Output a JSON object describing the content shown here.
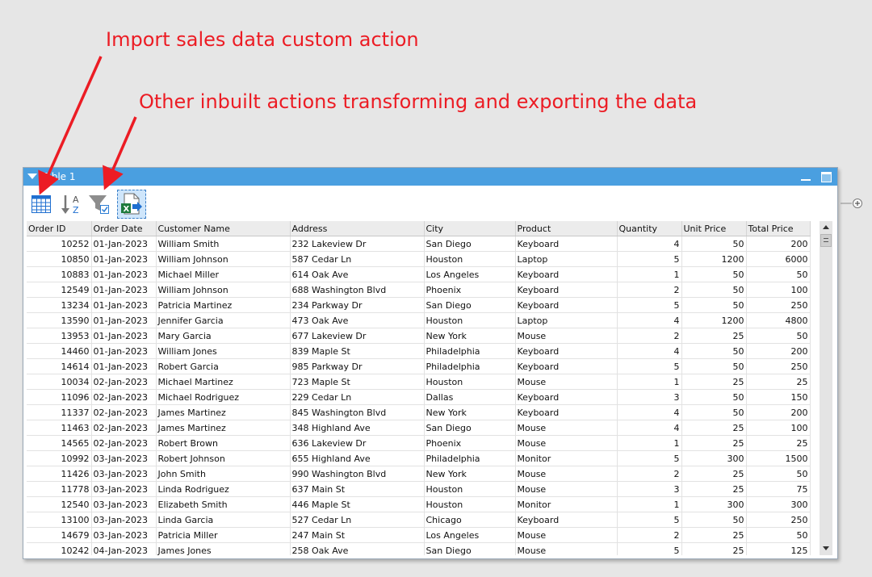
{
  "annotations": {
    "custom_action": "Import sales data custom action",
    "inbuilt_actions": "Other inbuilt actions transforming and exporting the data",
    "color": "#ec1c24"
  },
  "panel": {
    "title": "Table 1",
    "accent": "#4a9fe0"
  },
  "toolbar": {
    "buttons": [
      {
        "icon": "table-grid-icon",
        "purpose": "import-sales-data"
      },
      {
        "icon": "sort-az-icon",
        "purpose": "sort"
      },
      {
        "icon": "filter-icon",
        "purpose": "filter"
      },
      {
        "icon": "export-excel-icon",
        "purpose": "export",
        "active": true
      }
    ],
    "sort_letters": {
      "top": "A",
      "bottom": "Z"
    },
    "excel_letter": "X"
  },
  "table": {
    "columns": [
      "Order ID",
      "Order Date",
      "Customer Name",
      "Address",
      "City",
      "Product",
      "Quantity",
      "Unit Price",
      "Total Price"
    ],
    "rows": [
      [
        "10252",
        "01-Jan-2023",
        "William Smith",
        "232 Lakeview Dr",
        "San Diego",
        "Keyboard",
        "4",
        "50",
        "200"
      ],
      [
        "10850",
        "01-Jan-2023",
        "William Johnson",
        "587 Cedar Ln",
        "Houston",
        "Laptop",
        "5",
        "1200",
        "6000"
      ],
      [
        "10883",
        "01-Jan-2023",
        "Michael Miller",
        "614 Oak Ave",
        "Los Angeles",
        "Keyboard",
        "1",
        "50",
        "50"
      ],
      [
        "12549",
        "01-Jan-2023",
        "William Johnson",
        "688 Washington Blvd",
        "Phoenix",
        "Keyboard",
        "2",
        "50",
        "100"
      ],
      [
        "13234",
        "01-Jan-2023",
        "Patricia Martinez",
        "234 Parkway Dr",
        "San Diego",
        "Keyboard",
        "5",
        "50",
        "250"
      ],
      [
        "13590",
        "01-Jan-2023",
        "Jennifer Garcia",
        "473 Oak Ave",
        "Houston",
        "Laptop",
        "4",
        "1200",
        "4800"
      ],
      [
        "13953",
        "01-Jan-2023",
        "Mary Garcia",
        "677 Lakeview Dr",
        "New York",
        "Mouse",
        "2",
        "25",
        "50"
      ],
      [
        "14460",
        "01-Jan-2023",
        "William Jones",
        "839 Maple St",
        "Philadelphia",
        "Keyboard",
        "4",
        "50",
        "200"
      ],
      [
        "14614",
        "01-Jan-2023",
        "Robert Garcia",
        "985 Parkway Dr",
        "Philadelphia",
        "Keyboard",
        "5",
        "50",
        "250"
      ],
      [
        "10034",
        "02-Jan-2023",
        "Michael Martinez",
        "723 Maple St",
        "Houston",
        "Mouse",
        "1",
        "25",
        "25"
      ],
      [
        "11096",
        "02-Jan-2023",
        "Michael Rodriguez",
        "229 Cedar Ln",
        "Dallas",
        "Keyboard",
        "3",
        "50",
        "150"
      ],
      [
        "11337",
        "02-Jan-2023",
        "James Martinez",
        "845 Washington Blvd",
        "New York",
        "Keyboard",
        "4",
        "50",
        "200"
      ],
      [
        "11463",
        "02-Jan-2023",
        "James Martinez",
        "348 Highland Ave",
        "San Diego",
        "Mouse",
        "4",
        "25",
        "100"
      ],
      [
        "14565",
        "02-Jan-2023",
        "Robert Brown",
        "636 Lakeview Dr",
        "Phoenix",
        "Mouse",
        "1",
        "25",
        "25"
      ],
      [
        "10992",
        "03-Jan-2023",
        "Robert Johnson",
        "655 Highland Ave",
        "Philadelphia",
        "Monitor",
        "5",
        "300",
        "1500"
      ],
      [
        "11426",
        "03-Jan-2023",
        "John Smith",
        "990 Washington Blvd",
        "New York",
        "Mouse",
        "2",
        "25",
        "50"
      ],
      [
        "11778",
        "03-Jan-2023",
        "Linda Rodriguez",
        "637 Main St",
        "Houston",
        "Mouse",
        "3",
        "25",
        "75"
      ],
      [
        "12540",
        "03-Jan-2023",
        "Elizabeth Smith",
        "446 Maple St",
        "Houston",
        "Monitor",
        "1",
        "300",
        "300"
      ],
      [
        "13100",
        "03-Jan-2023",
        "Linda Garcia",
        "527 Cedar Ln",
        "Chicago",
        "Keyboard",
        "5",
        "50",
        "250"
      ],
      [
        "14679",
        "03-Jan-2023",
        "Patricia Miller",
        "247 Main St",
        "Los Angeles",
        "Mouse",
        "2",
        "25",
        "50"
      ],
      [
        "10242",
        "04-Jan-2023",
        "James Jones",
        "258 Oak Ave",
        "San Diego",
        "Mouse",
        "5",
        "25",
        "125"
      ]
    ]
  }
}
